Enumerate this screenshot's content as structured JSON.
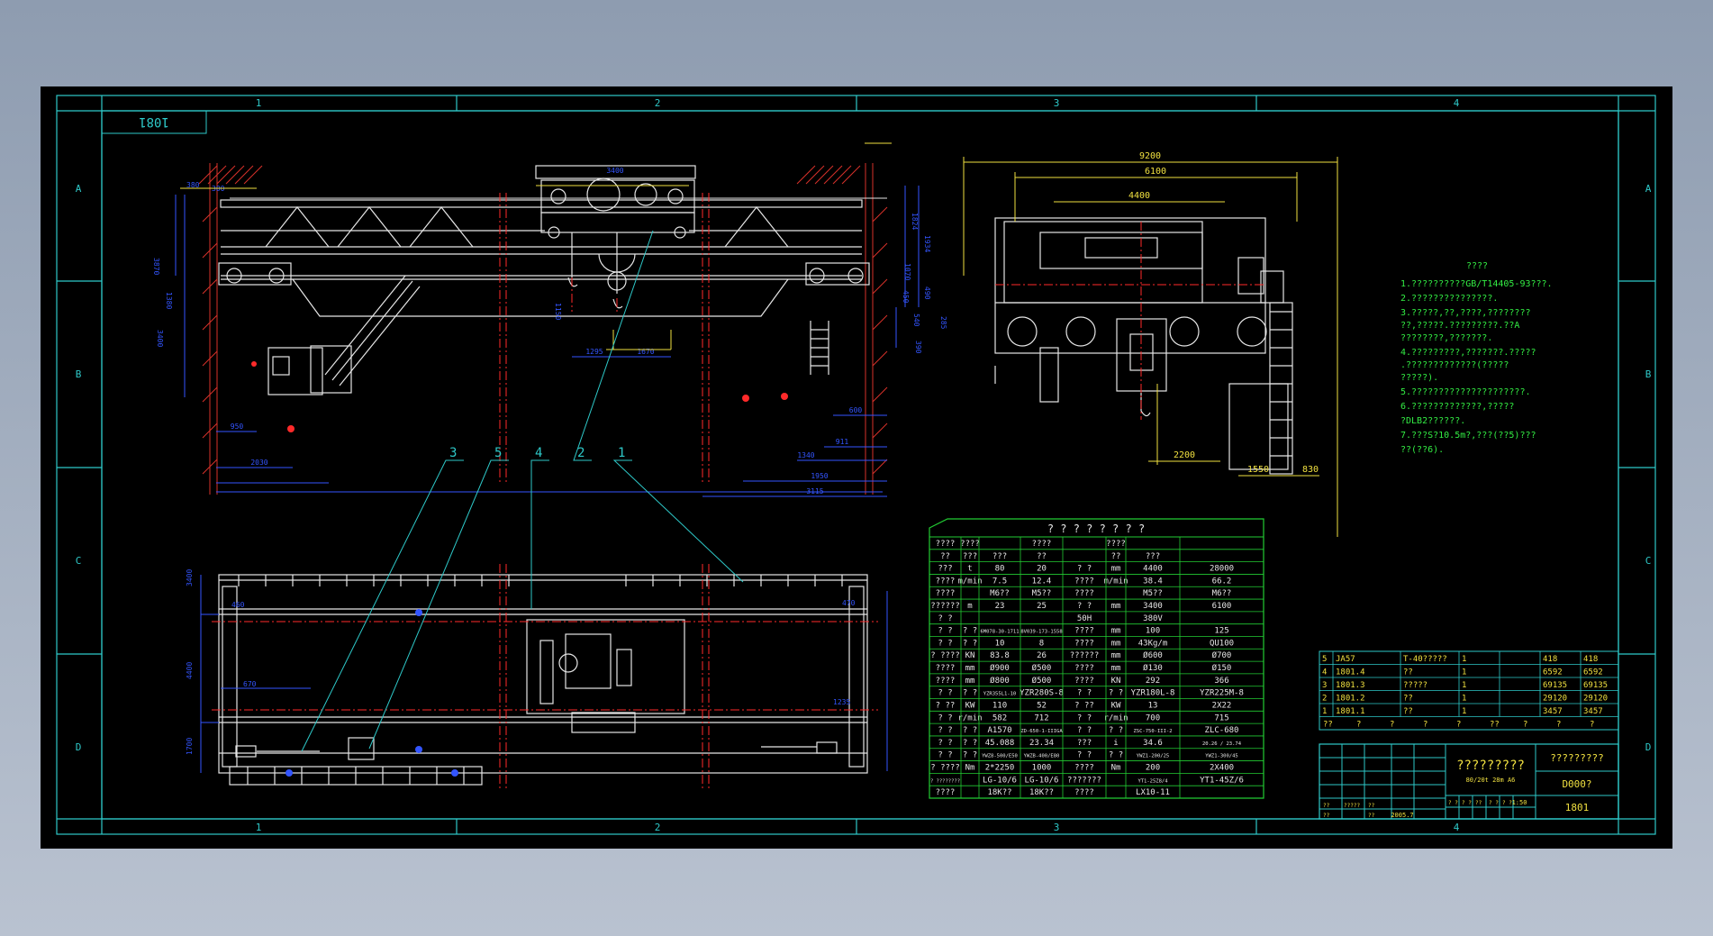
{
  "frame": {
    "zones_top": [
      "1",
      "2",
      "3",
      "4"
    ],
    "zones_bottom": [
      "1",
      "2",
      "3",
      "4"
    ],
    "zones_side": [
      "A",
      "B",
      "C",
      "D"
    ],
    "drawing_number_box": "1081"
  },
  "dimensions": {
    "side": [
      "3400",
      "1824",
      "1934",
      "1070",
      "450",
      "490",
      "540",
      "285",
      "390",
      "1295",
      "1670",
      "1150",
      "600",
      "911",
      "1340",
      "1950",
      "3115",
      "2030",
      "950",
      "380",
      "300",
      "3870",
      "1380",
      "3400"
    ],
    "top_right": [
      "9200",
      "6100",
      "4400",
      "2200",
      "1550",
      "830"
    ],
    "plan": [
      "3400",
      "460",
      "4400",
      "1700",
      "670",
      "470",
      "1235"
    ]
  },
  "leaders": [
    "3",
    "5",
    "4",
    "2",
    "1"
  ],
  "notes": {
    "title": "????",
    "lines": [
      "1.??????????GB/T14405-93???.",
      "2.???????????????.",
      "3.?????,??,????,????????",
      "  ??,?????.?????????.??A",
      "  ????????,???????.",
      "4.?????????,???????.?????",
      "  .?????????????(?????",
      "  ?????).",
      "5.?????????????????????.",
      "6.?????????????,?????",
      "  ?DLB2??????.",
      "7.???S?10.5m?,???(??5)???",
      "  ??(??6)."
    ]
  },
  "spec_table": {
    "title": "? ? ? ? ? ? ? ?",
    "rows": [
      [
        "????",
        "????",
        "",
        "????",
        "",
        "????",
        ""
      ],
      [
        "??",
        "???",
        "???",
        "??",
        "",
        "??",
        "???"
      ],
      [
        "???",
        "t",
        "80",
        "20",
        "? ?",
        "mm",
        "4400",
        "28000"
      ],
      [
        "????",
        "m/min",
        "7.5",
        "12.4",
        "????",
        "m/min",
        "38.4",
        "66.2"
      ],
      [
        "????",
        "",
        "M6??",
        "M5??",
        "????",
        "",
        "M5??",
        "M6??"
      ],
      [
        "??????",
        "m",
        "23",
        "25",
        "? ?",
        "mm",
        "3400",
        "6100"
      ],
      [
        "? ?",
        "",
        "",
        "",
        "50H",
        "",
        "380V",
        ""
      ],
      [
        "? ?",
        "? ?",
        "6M078-30-1711",
        "8V039-173-1558",
        "????",
        "mm",
        "100",
        "125"
      ],
      [
        "? ?",
        "? ?",
        "10",
        "8",
        "????",
        "mm",
        "43Kg/m",
        "QU100"
      ],
      [
        "? ????",
        "KN",
        "83.8",
        "26",
        "??????",
        "mm",
        "Ø600",
        "Ø700"
      ],
      [
        "????",
        "mm",
        "Ø900",
        "Ø500",
        "????",
        "mm",
        "Ø130",
        "Ø150"
      ],
      [
        "????",
        "mm",
        "Ø800",
        "Ø500",
        "????",
        "KN",
        "292",
        "366"
      ],
      [
        "? ?",
        "? ?",
        "YZR355L1-10",
        "YZR280S-8",
        "? ?",
        "? ?",
        "YZR180L-8",
        "YZR225M-8"
      ],
      [
        "? ??",
        "KW",
        "110",
        "52",
        "? ??",
        "KW",
        "13",
        "2X22"
      ],
      [
        "? ?",
        "r/min",
        "582",
        "712",
        "? ?",
        "r/min",
        "700",
        "715"
      ],
      [
        "? ?",
        "? ?",
        "A1570",
        "ZD-650-1-IIIGA",
        "? ?",
        "? ?",
        "ZSC-750-III-2",
        "ZLC-680"
      ],
      [
        "? ?",
        "? ?",
        "45.088",
        "23.34",
        "???",
        "i",
        "34.6",
        "20.26 / 23.74"
      ],
      [
        "? ?",
        "? ?",
        "YWZ8-500/E50",
        "YWZB-400/E80",
        "? ?",
        "? ?",
        "YWZ1-200/25",
        "YWZ1-300/45"
      ],
      [
        "? ????",
        "Nm",
        "2*2250",
        "1000",
        "????",
        "Nm",
        "200",
        "2X400"
      ],
      [
        "? ????????",
        "",
        "LG-10/6",
        "LG-10/6",
        "???????",
        "",
        "YT1-25Z8/4",
        "YT1-45Z/6"
      ],
      [
        "????",
        "",
        "18K??",
        "18K??",
        "????",
        "",
        "LX10-11",
        ""
      ]
    ]
  },
  "parts_list": {
    "rows": [
      [
        "5",
        "JA57",
        "T-40?????",
        "1",
        "418",
        "418"
      ],
      [
        "4",
        "1801.4",
        "??",
        "1",
        "6592",
        "6592"
      ],
      [
        "3",
        "1801.3",
        "?????",
        "1",
        "69135",
        "69135"
      ],
      [
        "2",
        "1801.2",
        "??",
        "1",
        "29120",
        "29120"
      ],
      [
        "1",
        "1801.1",
        "??",
        "1",
        "3457",
        "3457"
      ]
    ],
    "header": [
      "??",
      "?",
      "?",
      "?",
      "?",
      "??",
      "?",
      "?",
      "?"
    ]
  },
  "title_block": {
    "name": "?????????",
    "subtitle": "80/20t 28m A6",
    "company": "?????????",
    "code": "D000?",
    "scale": "1:50",
    "drawing_no": "1801",
    "date": "2005.7",
    "small_labels": [
      "??",
      "??",
      "?????",
      "??",
      "??",
      "? ?",
      "? ?",
      "??",
      "? ?",
      "? ?"
    ]
  },
  "colors": {
    "frame_cyan": "#2ec9c9",
    "drawing_white": "#e6e6e6",
    "dimension_blue": "#3355ff",
    "center_red": "#ff2a2a",
    "wall_hatch_red": "#d8322a",
    "text_green": "#33ee44",
    "table_green": "#22cc33",
    "yellow": "#f0e040"
  }
}
